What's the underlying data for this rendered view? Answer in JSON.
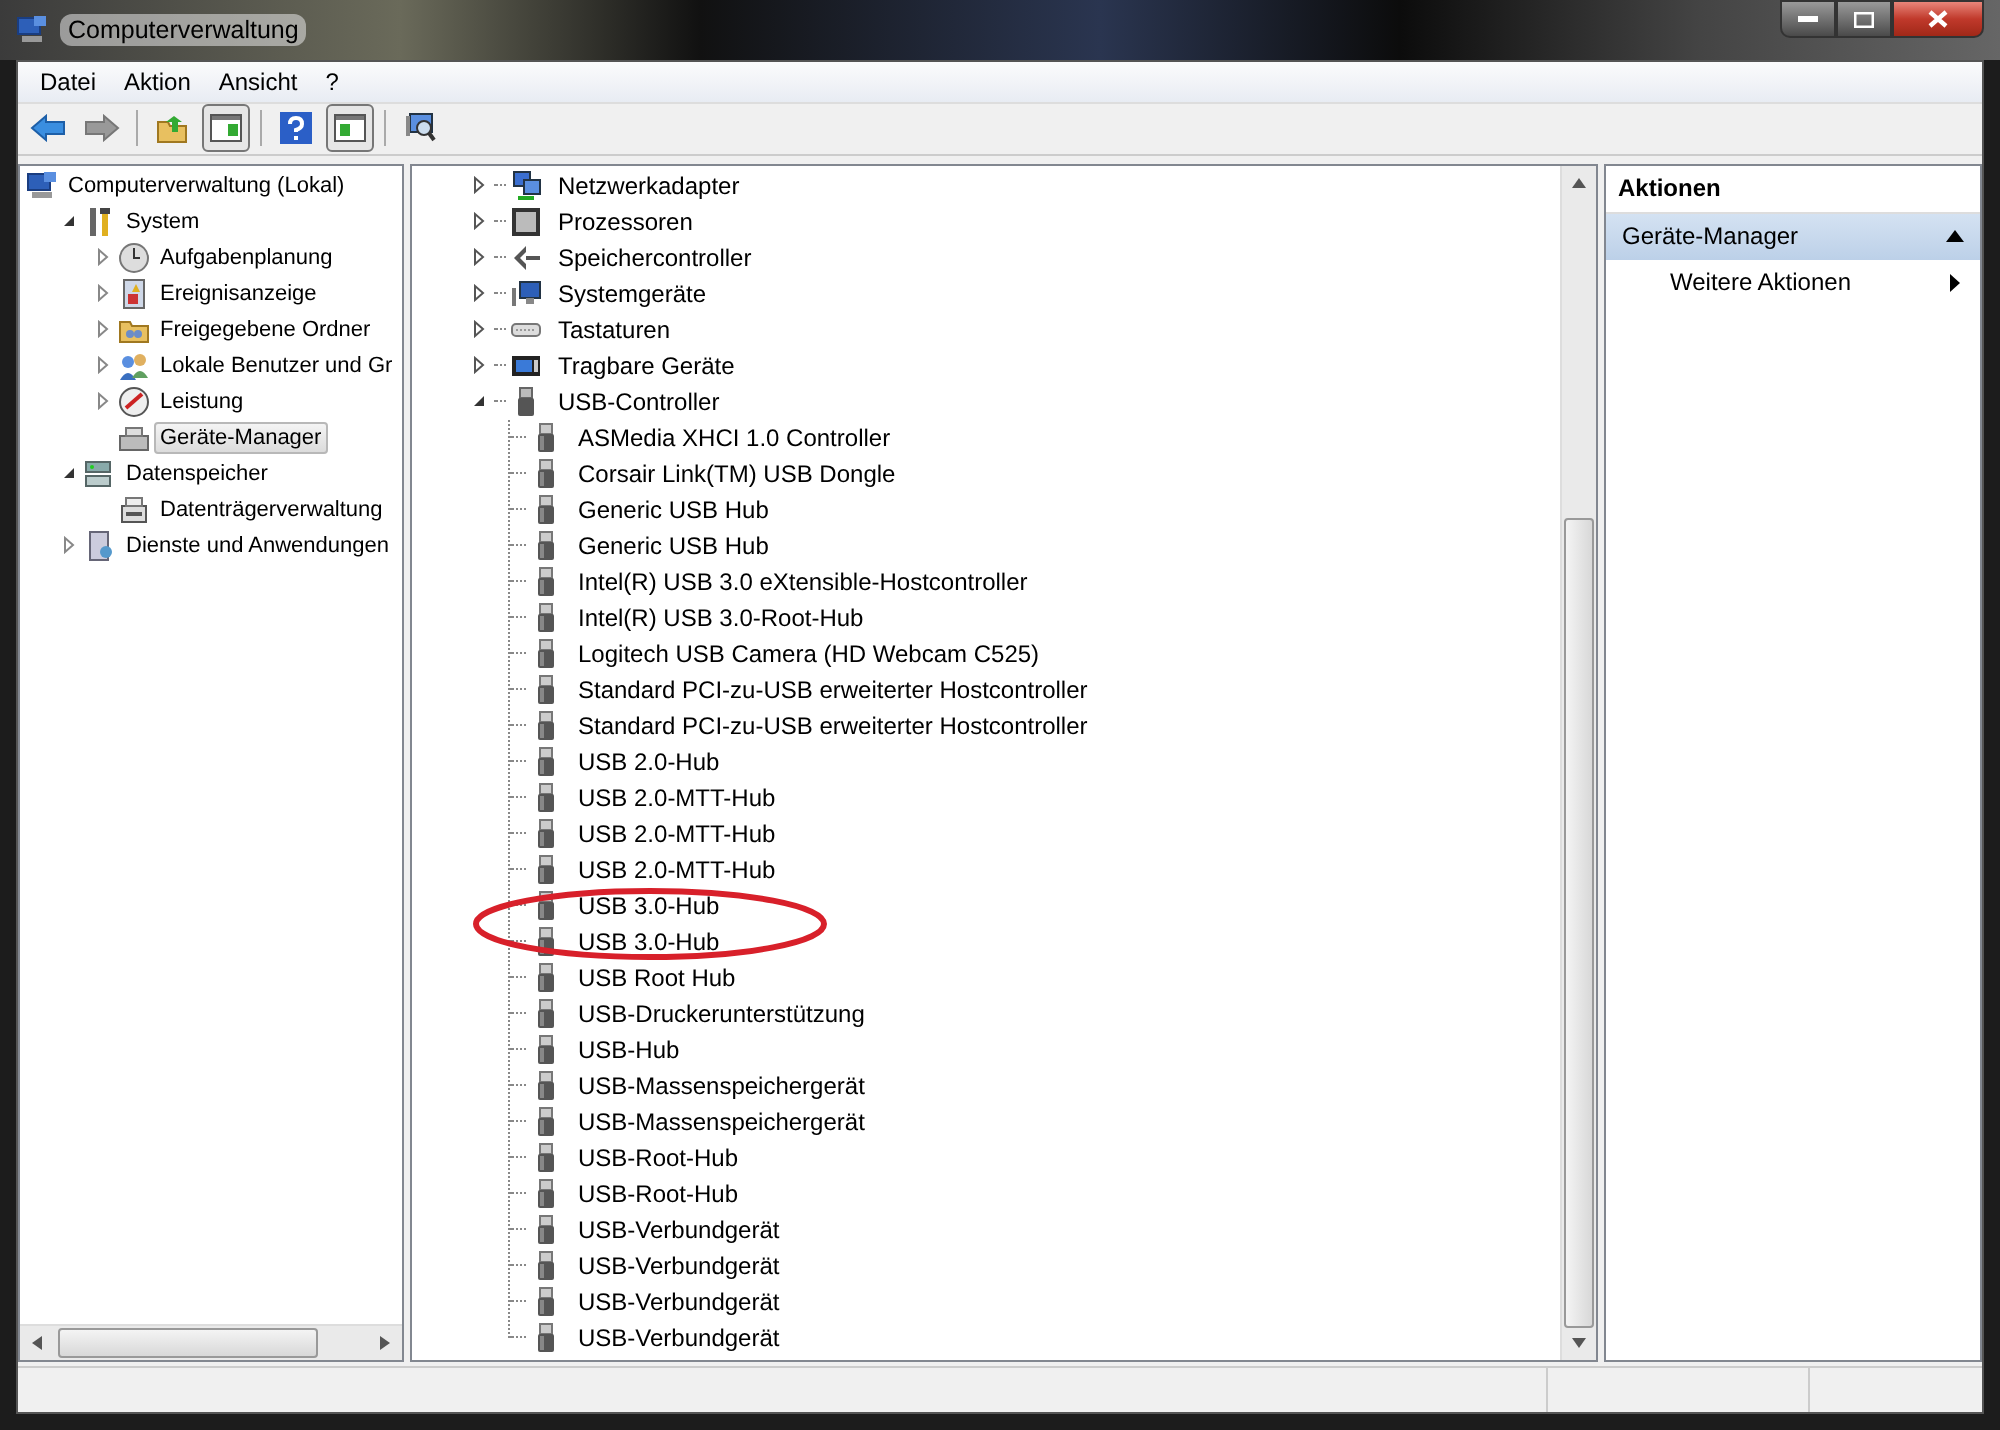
{
  "window": {
    "title": "Computerverwaltung"
  },
  "menu": [
    {
      "label": "Datei"
    },
    {
      "label": "Aktion"
    },
    {
      "label": "Ansicht"
    },
    {
      "label": "?"
    }
  ],
  "console_tree": {
    "items": [
      {
        "label": "Computerverwaltung (Lokal)",
        "selected": false,
        "children": [
          {
            "label": "System",
            "expanded": true,
            "selected": false,
            "children": [
              {
                "label": "Aufgabenplanung",
                "expanded": false,
                "selected": false
              },
              {
                "label": "Ereignisanzeige",
                "expanded": false,
                "selected": false
              },
              {
                "label": "Freigegebene Ordner",
                "expanded": false,
                "selected": false
              },
              {
                "label": "Lokale Benutzer und Gr",
                "expanded": false,
                "selected": false
              },
              {
                "label": "Leistung",
                "expanded": false,
                "selected": false
              },
              {
                "label": "Geräte-Manager",
                "selected": true
              }
            ]
          },
          {
            "label": "Datenspeicher",
            "expanded": true,
            "selected": false,
            "children": [
              {
                "label": "Datenträgerverwaltung",
                "selected": false
              }
            ]
          },
          {
            "label": "Dienste und Anwendungen",
            "expanded": false,
            "selected": false
          }
        ]
      }
    ]
  },
  "devices": [
    {
      "label": "Netzwerkadapter",
      "expanded": false
    },
    {
      "label": "Prozessoren",
      "expanded": false
    },
    {
      "label": "Speichercontroller",
      "expanded": false
    },
    {
      "label": "Systemgeräte",
      "expanded": false
    },
    {
      "label": "Tastaturen",
      "expanded": false
    },
    {
      "label": "Tragbare Geräte",
      "expanded": false
    },
    {
      "label": "USB-Controller",
      "expanded": true,
      "children": [
        {
          "label": "ASMedia XHCI 1.0 Controller",
          "circled": false
        },
        {
          "label": "Corsair Link(TM) USB Dongle",
          "circled": false
        },
        {
          "label": "Generic USB Hub",
          "circled": false
        },
        {
          "label": "Generic USB Hub",
          "circled": false
        },
        {
          "label": "Intel(R) USB 3.0 eXtensible-Hostcontroller",
          "circled": false
        },
        {
          "label": "Intel(R) USB 3.0-Root-Hub",
          "circled": false
        },
        {
          "label": "Logitech USB Camera (HD Webcam C525)",
          "circled": false
        },
        {
          "label": "Standard PCI-zu-USB erweiterter Hostcontroller",
          "circled": false
        },
        {
          "label": "Standard PCI-zu-USB erweiterter Hostcontroller",
          "circled": false
        },
        {
          "label": "USB 2.0-Hub",
          "circled": false
        },
        {
          "label": "USB 2.0-MTT-Hub",
          "circled": false
        },
        {
          "label": "USB 2.0-MTT-Hub",
          "circled": false
        },
        {
          "label": "USB 2.0-MTT-Hub",
          "circled": false
        },
        {
          "label": "USB 3.0-Hub",
          "circled": true
        },
        {
          "label": "USB 3.0-Hub",
          "circled": true
        },
        {
          "label": "USB Root Hub",
          "circled": false
        },
        {
          "label": "USB-Druckerunterstützung",
          "circled": false
        },
        {
          "label": "USB-Hub",
          "circled": false
        },
        {
          "label": "USB-Massenspeichergerät",
          "circled": false
        },
        {
          "label": "USB-Massenspeichergerät",
          "circled": false
        },
        {
          "label": "USB-Root-Hub",
          "circled": false
        },
        {
          "label": "USB-Root-Hub",
          "circled": false
        },
        {
          "label": "USB-Verbundgerät",
          "circled": false
        },
        {
          "label": "USB-Verbundgerät",
          "circled": false
        },
        {
          "label": "USB-Verbundgerät",
          "circled": false
        },
        {
          "label": "USB-Verbundgerät",
          "circled": false
        }
      ]
    }
  ],
  "actions": {
    "heading": "Aktionen",
    "sections": [
      {
        "title": "Geräte-Manager",
        "expanded": true,
        "items": [
          {
            "label": "Weitere Aktionen"
          }
        ]
      }
    ]
  }
}
